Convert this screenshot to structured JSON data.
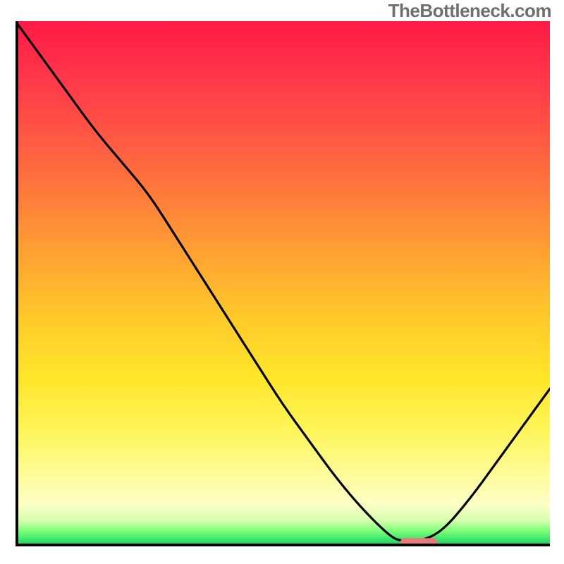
{
  "watermark": "TheBottleneck.com",
  "colors": {
    "curve_stroke": "#000000",
    "marker_fill": "#e87a7a",
    "axis": "#000000"
  },
  "chart_data": {
    "type": "line",
    "title": "",
    "xlabel": "",
    "ylabel": "",
    "xlim": [
      0,
      100
    ],
    "ylim": [
      0,
      100
    ],
    "grid": false,
    "legend": false,
    "series": [
      {
        "name": "curve",
        "x": [
          0,
          5,
          10,
          15,
          20,
          25,
          30,
          35,
          40,
          45,
          50,
          55,
          60,
          65,
          70,
          72,
          76,
          80,
          85,
          90,
          95,
          100
        ],
        "y": [
          100,
          93,
          86,
          79,
          73,
          67,
          59,
          51,
          43,
          35,
          27,
          20,
          13,
          7,
          2,
          1,
          1,
          3,
          9,
          16,
          23,
          30
        ]
      }
    ],
    "marker": {
      "x_start": 72,
      "x_end": 79,
      "y": 0.7,
      "shape": "rounded-bar"
    }
  }
}
